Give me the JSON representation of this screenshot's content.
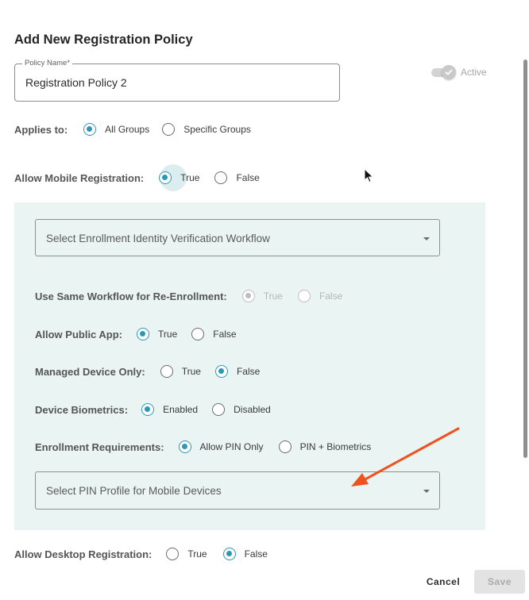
{
  "dialog": {
    "title": "Add New Registration Policy"
  },
  "policy_name": {
    "label": "Policy Name*",
    "value": "Registration Policy 2"
  },
  "active_toggle": {
    "label": "Active",
    "on": true
  },
  "applies_to": {
    "label": "Applies to:",
    "options": [
      "All Groups",
      "Specific Groups"
    ],
    "selected": "All Groups"
  },
  "allow_mobile": {
    "label": "Allow Mobile Registration:",
    "options": [
      "True",
      "False"
    ],
    "selected": "True"
  },
  "mobile_section": {
    "workflow_select": {
      "placeholder": "Select Enrollment Identity Verification Workflow"
    },
    "reenrollment": {
      "label": "Use Same Workflow for Re-Enrollment:",
      "options": [
        "True",
        "False"
      ],
      "selected": "True",
      "disabled": true
    },
    "public_app": {
      "label": "Allow Public App:",
      "options": [
        "True",
        "False"
      ],
      "selected": "True"
    },
    "managed_device": {
      "label": "Managed Device Only:",
      "options": [
        "True",
        "False"
      ],
      "selected": "False"
    },
    "biometrics": {
      "label": "Device Biometrics:",
      "options": [
        "Enabled",
        "Disabled"
      ],
      "selected": "Enabled"
    },
    "enrollment_req": {
      "label": "Enrollment Requirements:",
      "options": [
        "Allow PIN Only",
        "PIN + Biometrics"
      ],
      "selected": "Allow PIN Only"
    },
    "pin_select": {
      "placeholder": "Select PIN Profile for Mobile Devices"
    }
  },
  "allow_desktop": {
    "label": "Allow Desktop Registration:",
    "options": [
      "True",
      "False"
    ],
    "selected": "False"
  },
  "footer": {
    "cancel_label": "Cancel",
    "save_label": "Save"
  },
  "colors": {
    "accent": "#2e97b8",
    "panel_bg": "#eaf4f3",
    "annotation_arrow": "#f0521f"
  },
  "icons": {
    "toggle_check": "check-icon",
    "dropdown": "chevron-down-icon",
    "cursor": "mouse-pointer-icon",
    "annotation": "arrow-icon"
  }
}
